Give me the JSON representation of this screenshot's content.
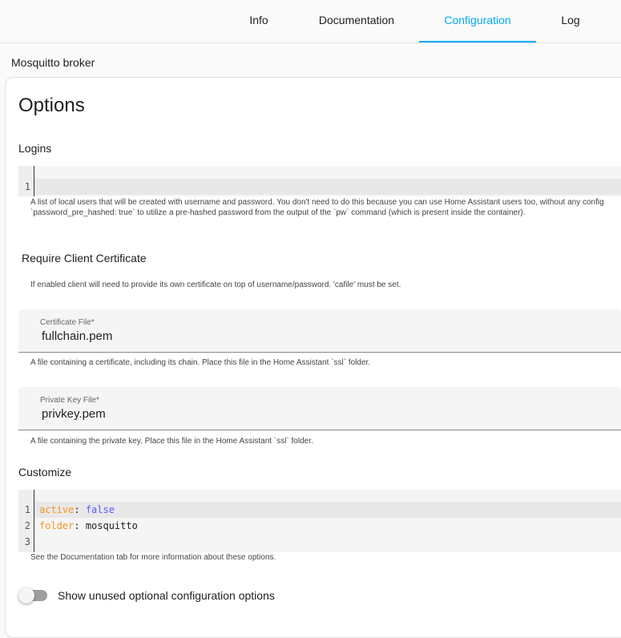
{
  "tabs": [
    {
      "label": "Info"
    },
    {
      "label": "Documentation"
    },
    {
      "label": "Configuration",
      "active": true
    },
    {
      "label": "Log"
    }
  ],
  "addon_name": "Mosquitto broker",
  "card": {
    "title": "Options",
    "logins": {
      "label": "Logins",
      "lines": [
        "1"
      ],
      "desc1": "A list of local users that will be created with username and password. You don't need to do this because you can use Home Assistant users too, without any config",
      "desc2": "`password_pre_hashed: true` to utilize a pre-hashed password from the output of the `pw` command (which is present inside the container)."
    },
    "require_cert": {
      "label": "Require Client Certificate",
      "desc": "If enabled client will need to provide its own certificate on top of username/password. 'cafile' must be set."
    },
    "certfile": {
      "label": "Certificate File*",
      "value": "fullchain.pem",
      "desc": "A file containing a certificate, including its chain. Place this file in the Home Assistant `ssl` folder."
    },
    "keyfile": {
      "label": "Private Key File*",
      "value": "privkey.pem",
      "desc": "A file containing the private key. Place this file in the Home Assistant `ssl` folder."
    },
    "customize": {
      "label": "Customize",
      "line_numbers": [
        "1",
        "2",
        "3"
      ],
      "line1_key": "active",
      "line1_val": "false",
      "line2_key": "folder",
      "line2_val": "mosquitto",
      "sep": ": ",
      "desc": "See the Documentation tab for more information about these options."
    },
    "show_unused": {
      "label": "Show unused optional configuration options",
      "enabled": false
    }
  },
  "colors": {
    "accent": "#03a9f4",
    "yaml_key": "#f5961e",
    "yaml_bool": "#5a5aff"
  }
}
